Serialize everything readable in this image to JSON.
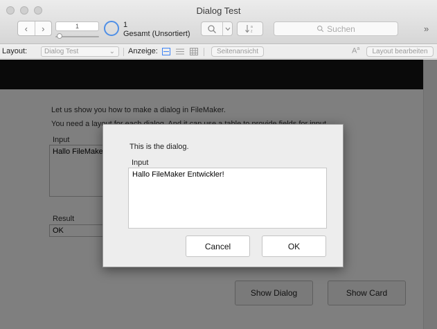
{
  "window": {
    "title": "Dialog Test"
  },
  "toolbar": {
    "nav_back_glyph": "‹",
    "nav_forward_glyph": "›",
    "current_record": "1",
    "found_count": "1",
    "found_label": "Gesamt (Unsortiert)",
    "search_placeholder": "Suchen",
    "overflow_glyph": "»"
  },
  "layout_bar": {
    "layout_label": "Layout:",
    "layout_value": "Dialog Test",
    "view_label": "Anzeige:",
    "preview_label": "Seitenansicht",
    "edit_layout_label": "Layout bearbeiten",
    "active_view_color": "#3b82f6"
  },
  "content": {
    "intro_line1": "Let us show you how to make a dialog in FileMaker.",
    "intro_line2": "You need a layout for each dialog. And it can use a table to provide fields for input",
    "input_label": "Input",
    "input_value": "Hallo FileMaker",
    "result_label": "Result",
    "result_value": "OK",
    "show_dialog_label": "Show Dialog",
    "show_card_label": "Show Card"
  },
  "dialog": {
    "message": "This is the dialog.",
    "input_label": "Input",
    "input_value": "Hallo FileMaker Entwickler!",
    "cancel_label": "Cancel",
    "ok_label": "OK"
  }
}
